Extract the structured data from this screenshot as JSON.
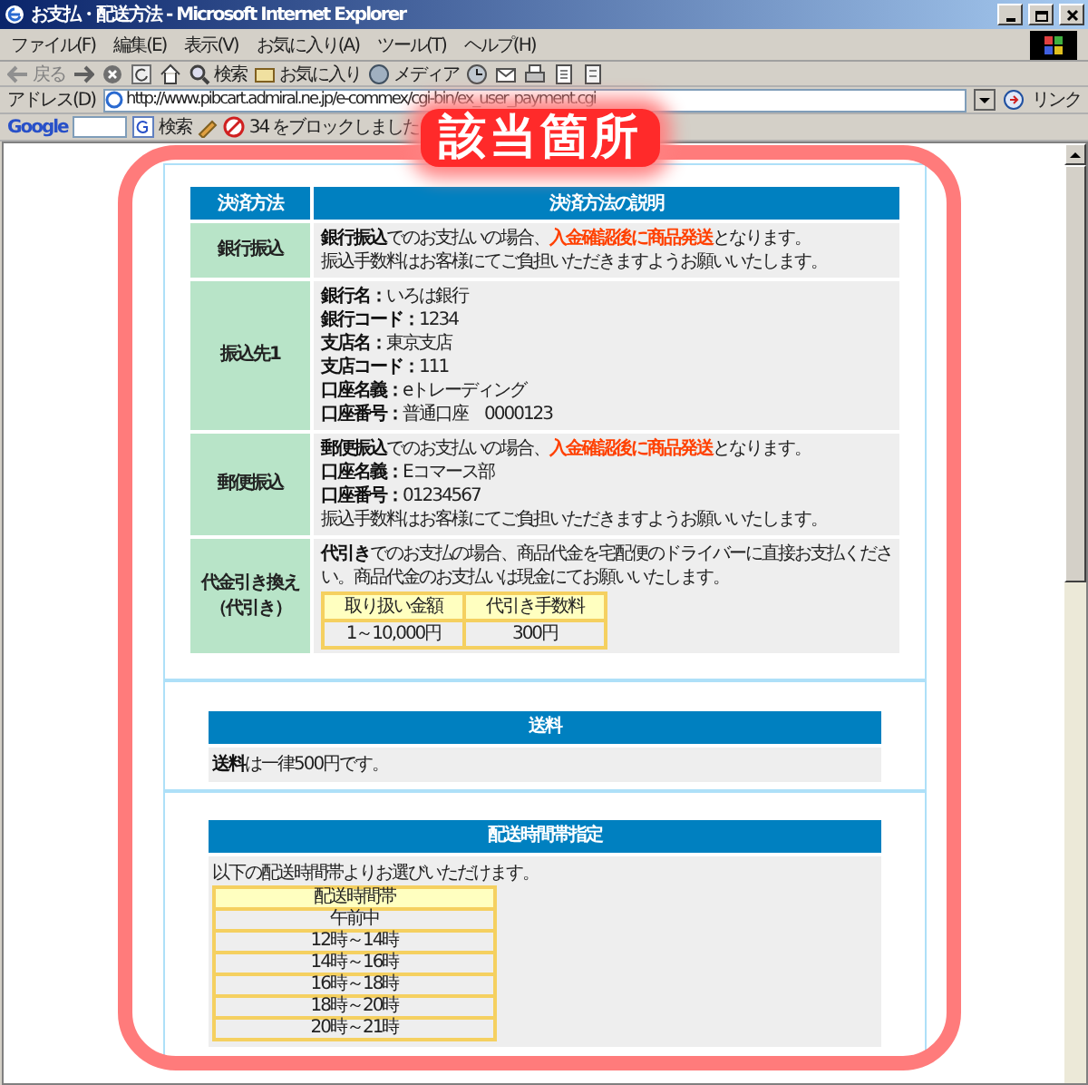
{
  "window": {
    "title": "お支払・配送方法 - Microsoft Internet Explorer"
  },
  "menu": [
    "ファイル(F)",
    "編集(E)",
    "表示(V)",
    "お気に入り(A)",
    "ツール(T)",
    "ヘルプ(H)"
  ],
  "toolbar": {
    "back_label": "戻る",
    "search_label": "検索",
    "favorites_label": "お気に入り",
    "media_label": "メディア"
  },
  "address_bar": {
    "label": "アドレス(D)",
    "url": "http://www.pibcart.admiral.ne.jp/e-commex/cgi-bin/ex_user_payment.cgi",
    "links_label": "リンク"
  },
  "google_bar": {
    "logo": "Google",
    "search_label": "検索",
    "blocked_label": "34 をブロックしました"
  },
  "annotation": {
    "label": "該当箇所"
  },
  "payment_table": {
    "columns": [
      "決済方法",
      "決済方法の説明"
    ],
    "rows": [
      {
        "method": [
          "銀行振込"
        ],
        "lines": [
          [
            {
              "text": "銀行振込",
              "kind": "bold"
            },
            {
              "text": "でのお支払いの場合、",
              "kind": "plain"
            },
            {
              "text": "入金確認後に商品発送",
              "kind": "alert"
            },
            {
              "text": "となります。",
              "kind": "plain"
            }
          ],
          [
            {
              "text": "振込手数料はお客様にてご負担いただきますようお願いいたします。",
              "kind": "plain"
            }
          ]
        ]
      },
      {
        "method": [
          "振込先1"
        ],
        "lines": [
          [
            {
              "text": "銀行名：",
              "kind": "bold"
            },
            {
              "text": "いろは銀行",
              "kind": "plain"
            }
          ],
          [
            {
              "text": "銀行コード：",
              "kind": "bold"
            },
            {
              "text": "1234",
              "kind": "plain"
            }
          ],
          [
            {
              "text": "支店名：",
              "kind": "bold"
            },
            {
              "text": "東京支店",
              "kind": "plain"
            }
          ],
          [
            {
              "text": "支店コード：",
              "kind": "bold"
            },
            {
              "text": "111",
              "kind": "plain"
            }
          ],
          [
            {
              "text": "口座名義：",
              "kind": "bold"
            },
            {
              "text": "eトレーディング",
              "kind": "plain"
            }
          ],
          [
            {
              "text": "口座番号：",
              "kind": "bold"
            },
            {
              "text": "普通口座　0000123",
              "kind": "plain"
            }
          ]
        ]
      },
      {
        "method": [
          "郵便振込"
        ],
        "lines": [
          [
            {
              "text": "郵便振込",
              "kind": "bold"
            },
            {
              "text": "でのお支払いの場合、",
              "kind": "plain"
            },
            {
              "text": "入金確認後に商品発送",
              "kind": "alert"
            },
            {
              "text": "となります。",
              "kind": "plain"
            }
          ],
          [
            {
              "text": "口座名義：",
              "kind": "bold"
            },
            {
              "text": "Eコマース部",
              "kind": "plain"
            }
          ],
          [
            {
              "text": "口座番号：",
              "kind": "bold"
            },
            {
              "text": "01234567",
              "kind": "plain"
            }
          ],
          [
            {
              "text": "振込手数料はお客様にてご負担いただきますようお願いいたします。",
              "kind": "plain"
            }
          ]
        ]
      },
      {
        "method": [
          "代金引き換え",
          "（代引き）"
        ],
        "lines": [
          [
            {
              "text": "代引き",
              "kind": "bold"
            },
            {
              "text": "でのお支払の場合、商品代金を宅配便のドライバーに直接お支払ください。商品代金のお支払いは現金にてお願いいたします。",
              "kind": "plain"
            }
          ]
        ],
        "fee_table": {
          "columns": [
            "取り扱い金額",
            "代引き手数料"
          ],
          "rows": [
            [
              "1～10,000円",
              "300円"
            ]
          ]
        }
      }
    ]
  },
  "shipping_fee": {
    "title": "送料",
    "lines": [
      [
        {
          "text": "送料",
          "kind": "bold"
        },
        {
          "text": "は一律500円です。",
          "kind": "plain"
        }
      ]
    ]
  },
  "delivery_time": {
    "title": "配送時間帯指定",
    "intro": "以下の配送時間帯よりお選びいただけます。",
    "table": {
      "header": "配送時間帯",
      "rows": [
        "午前中",
        "12時～14時",
        "14時～16時",
        "16時～18時",
        "18時～20時",
        "20時～21時"
      ]
    }
  }
}
